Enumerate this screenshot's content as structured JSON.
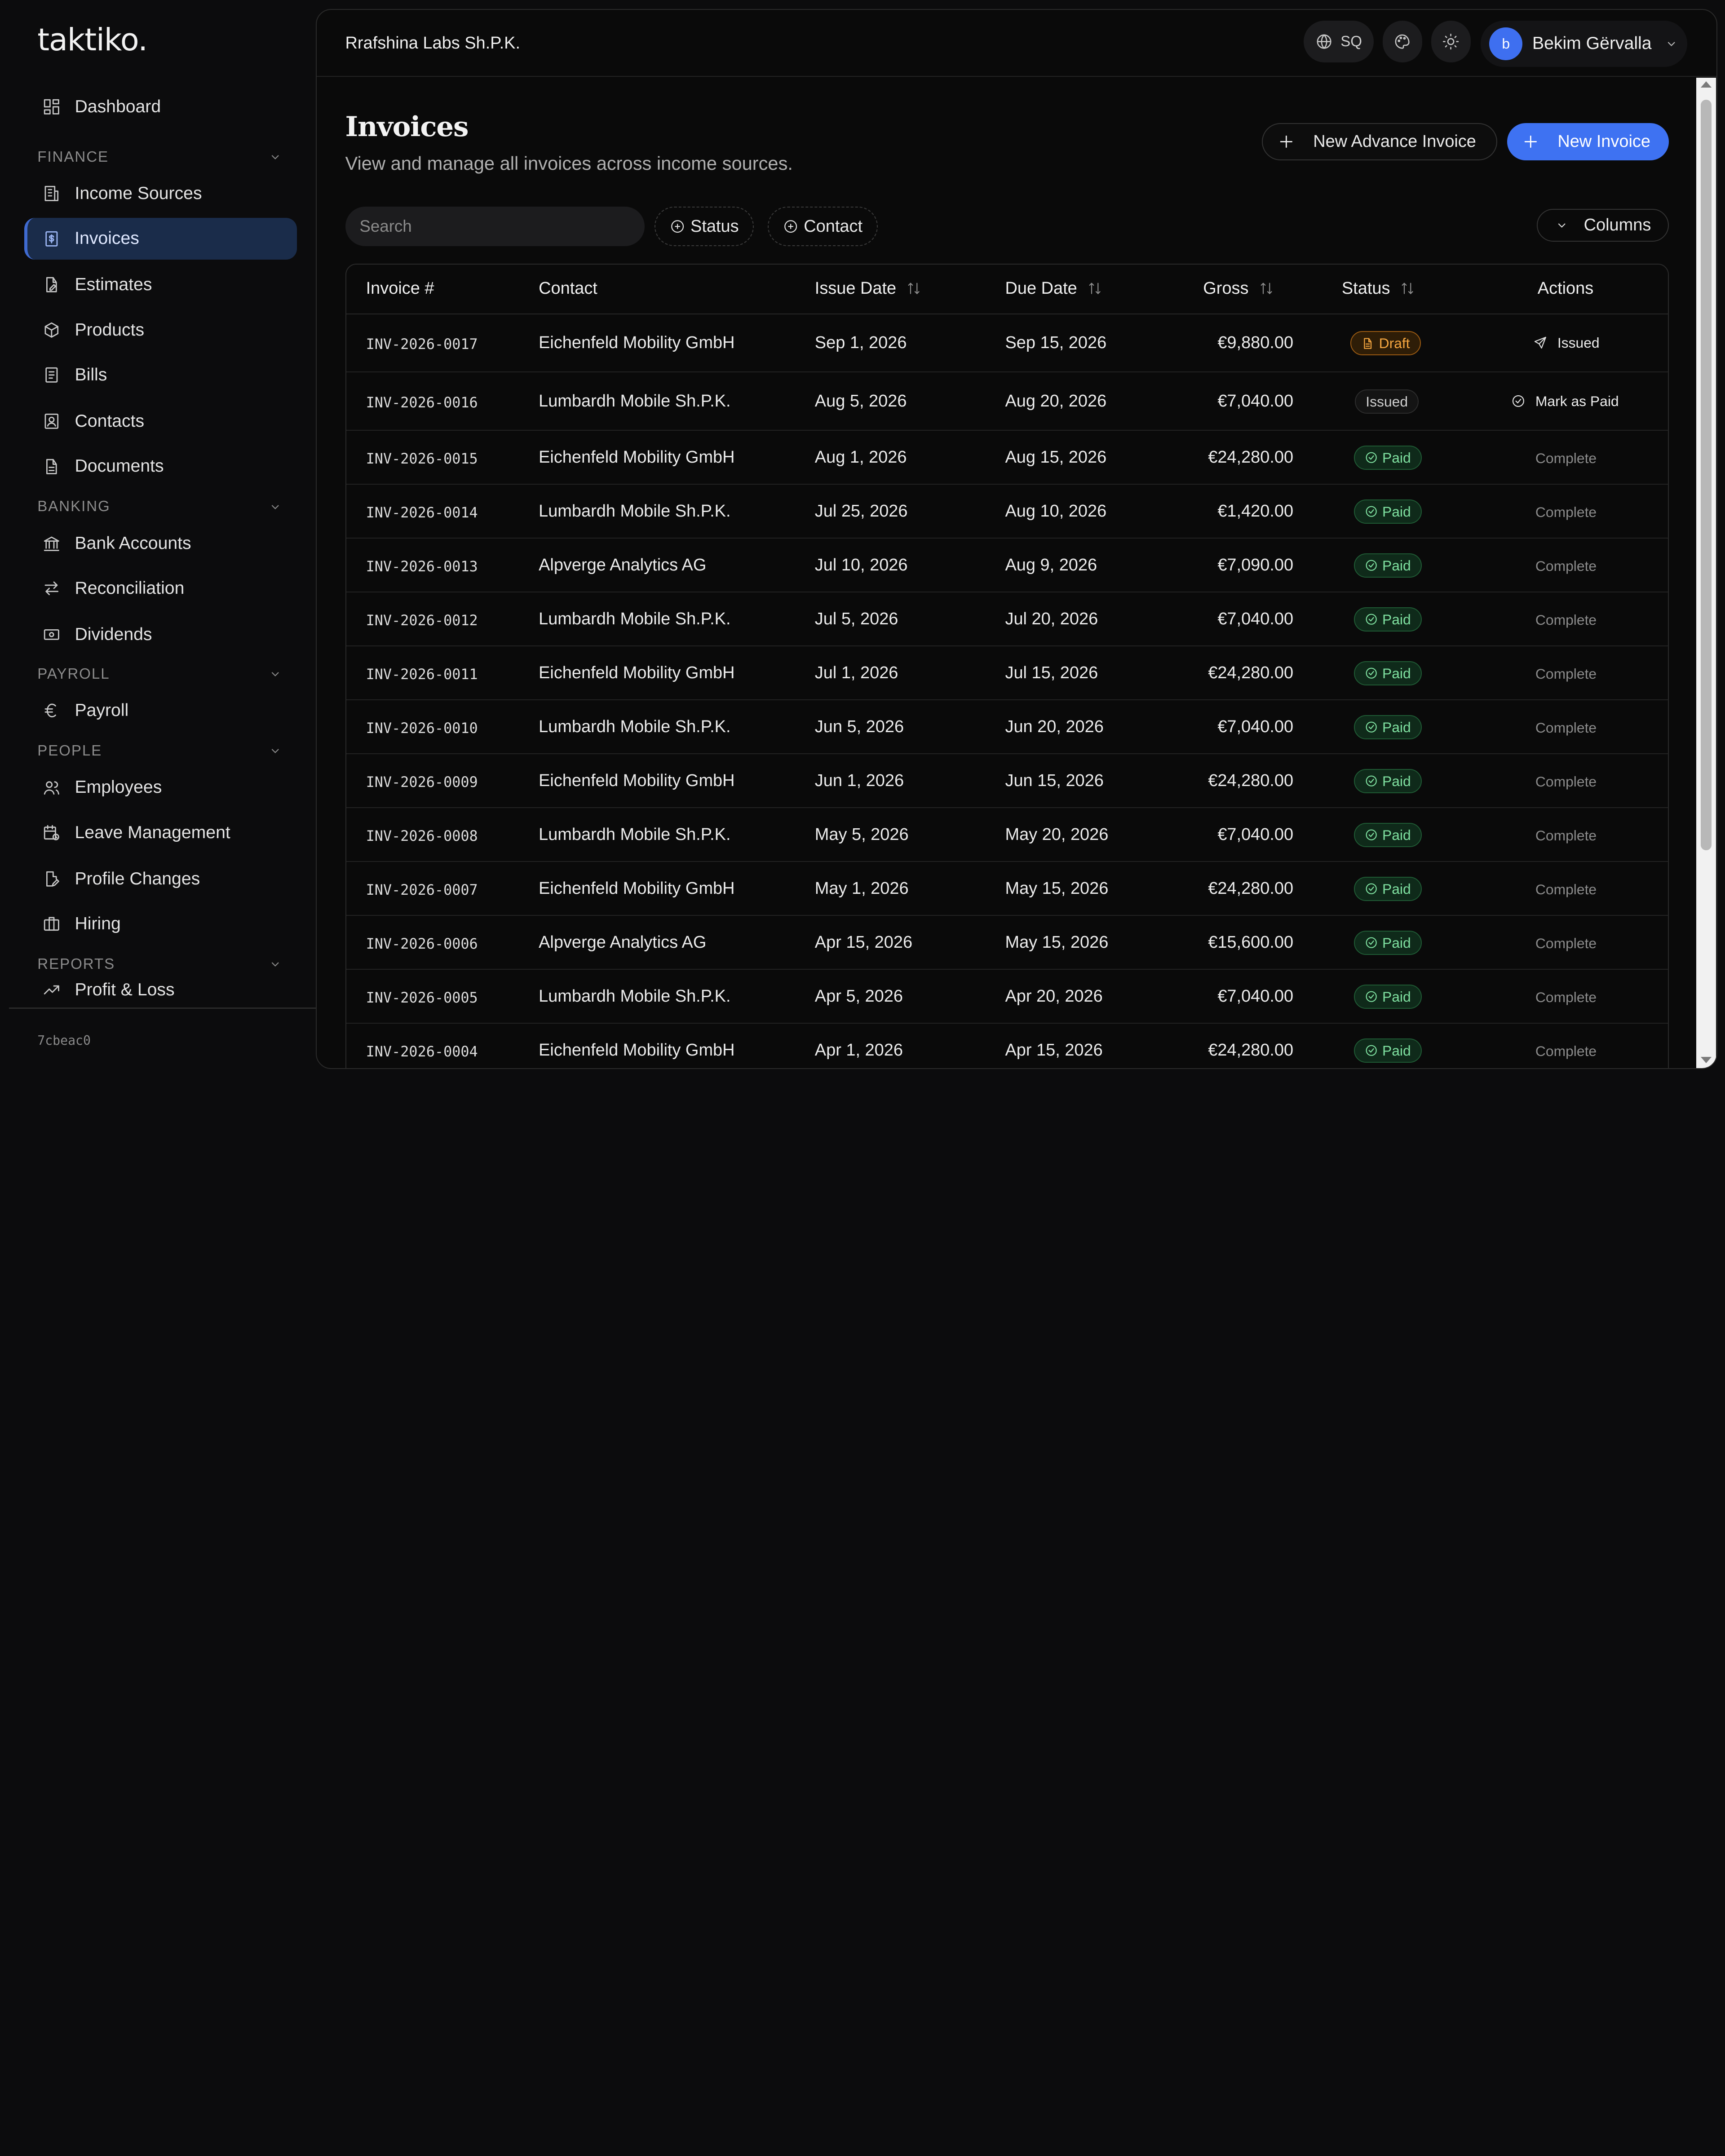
{
  "app": {
    "logo": "taktiko.",
    "version": "7cbeac0"
  },
  "sidebar": {
    "dashboard": "Dashboard",
    "sections": [
      {
        "title": "FINANCE",
        "items": [
          "Income Sources",
          "Invoices",
          "Estimates",
          "Products",
          "Bills",
          "Contacts",
          "Documents"
        ]
      },
      {
        "title": "BANKING",
        "items": [
          "Bank Accounts",
          "Reconciliation",
          "Dividends"
        ]
      },
      {
        "title": "PAYROLL",
        "items": [
          "Payroll"
        ]
      },
      {
        "title": "PEOPLE",
        "items": [
          "Employees",
          "Leave Management",
          "Profile Changes",
          "Hiring"
        ]
      },
      {
        "title": "REPORTS",
        "items": [
          "Profit & Loss"
        ]
      }
    ],
    "active": "Invoices"
  },
  "topbar": {
    "org_name": "Rrafshina Labs Sh.P.K.",
    "language": "SQ",
    "user_initial": "b",
    "user_name": "Bekim Gërvalla"
  },
  "page": {
    "title": "Invoices",
    "subtitle": "View and manage all invoices across income sources.",
    "new_advance_label": "New Advance Invoice",
    "new_invoice_label": "New Invoice",
    "search_placeholder": "Search",
    "filter_status": "Status",
    "filter_contact": "Contact",
    "columns_label": "Columns"
  },
  "table": {
    "headers": {
      "invoice": "Invoice #",
      "contact": "Contact",
      "issue_date": "Issue Date",
      "due_date": "Due Date",
      "gross": "Gross",
      "status": "Status",
      "actions": "Actions"
    },
    "rows": [
      {
        "invoice": "INV-2026-0017",
        "contact": "Eichenfeld Mobility GmbH",
        "issue": "Sep 1, 2026",
        "due": "Sep 15, 2026",
        "gross": "€9,880.00",
        "status": "Draft",
        "action": "Issued"
      },
      {
        "invoice": "INV-2026-0016",
        "contact": "Lumbardh Mobile Sh.P.K.",
        "issue": "Aug 5, 2026",
        "due": "Aug 20, 2026",
        "gross": "€7,040.00",
        "status": "Issued",
        "action": "Mark as Paid"
      },
      {
        "invoice": "INV-2026-0015",
        "contact": "Eichenfeld Mobility GmbH",
        "issue": "Aug 1, 2026",
        "due": "Aug 15, 2026",
        "gross": "€24,280.00",
        "status": "Paid",
        "action": "Complete"
      },
      {
        "invoice": "INV-2026-0014",
        "contact": "Lumbardh Mobile Sh.P.K.",
        "issue": "Jul 25, 2026",
        "due": "Aug 10, 2026",
        "gross": "€1,420.00",
        "status": "Paid",
        "action": "Complete"
      },
      {
        "invoice": "INV-2026-0013",
        "contact": "Alpverge Analytics AG",
        "issue": "Jul 10, 2026",
        "due": "Aug 9, 2026",
        "gross": "€7,090.00",
        "status": "Paid",
        "action": "Complete"
      },
      {
        "invoice": "INV-2026-0012",
        "contact": "Lumbardh Mobile Sh.P.K.",
        "issue": "Jul 5, 2026",
        "due": "Jul 20, 2026",
        "gross": "€7,040.00",
        "status": "Paid",
        "action": "Complete"
      },
      {
        "invoice": "INV-2026-0011",
        "contact": "Eichenfeld Mobility GmbH",
        "issue": "Jul 1, 2026",
        "due": "Jul 15, 2026",
        "gross": "€24,280.00",
        "status": "Paid",
        "action": "Complete"
      },
      {
        "invoice": "INV-2026-0010",
        "contact": "Lumbardh Mobile Sh.P.K.",
        "issue": "Jun 5, 2026",
        "due": "Jun 20, 2026",
        "gross": "€7,040.00",
        "status": "Paid",
        "action": "Complete"
      },
      {
        "invoice": "INV-2026-0009",
        "contact": "Eichenfeld Mobility GmbH",
        "issue": "Jun 1, 2026",
        "due": "Jun 15, 2026",
        "gross": "€24,280.00",
        "status": "Paid",
        "action": "Complete"
      },
      {
        "invoice": "INV-2026-0008",
        "contact": "Lumbardh Mobile Sh.P.K.",
        "issue": "May 5, 2026",
        "due": "May 20, 2026",
        "gross": "€7,040.00",
        "status": "Paid",
        "action": "Complete"
      },
      {
        "invoice": "INV-2026-0007",
        "contact": "Eichenfeld Mobility GmbH",
        "issue": "May 1, 2026",
        "due": "May 15, 2026",
        "gross": "€24,280.00",
        "status": "Paid",
        "action": "Complete"
      },
      {
        "invoice": "INV-2026-0006",
        "contact": "Alpverge Analytics AG",
        "issue": "Apr 15, 2026",
        "due": "May 15, 2026",
        "gross": "€15,600.00",
        "status": "Paid",
        "action": "Complete"
      },
      {
        "invoice": "INV-2026-0005",
        "contact": "Lumbardh Mobile Sh.P.K.",
        "issue": "Apr 5, 2026",
        "due": "Apr 20, 2026",
        "gross": "€7,040.00",
        "status": "Paid",
        "action": "Complete"
      },
      {
        "invoice": "INV-2026-0004",
        "contact": "Eichenfeld Mobility GmbH",
        "issue": "Apr 1, 2026",
        "due": "Apr 15, 2026",
        "gross": "€24,280.00",
        "status": "Paid",
        "action": "Complete"
      }
    ]
  },
  "colors": {
    "accent": "#3e72f2",
    "paid": "#7fe0a0",
    "draft": "#f5a640",
    "active_nav": "#1a2c4a"
  }
}
